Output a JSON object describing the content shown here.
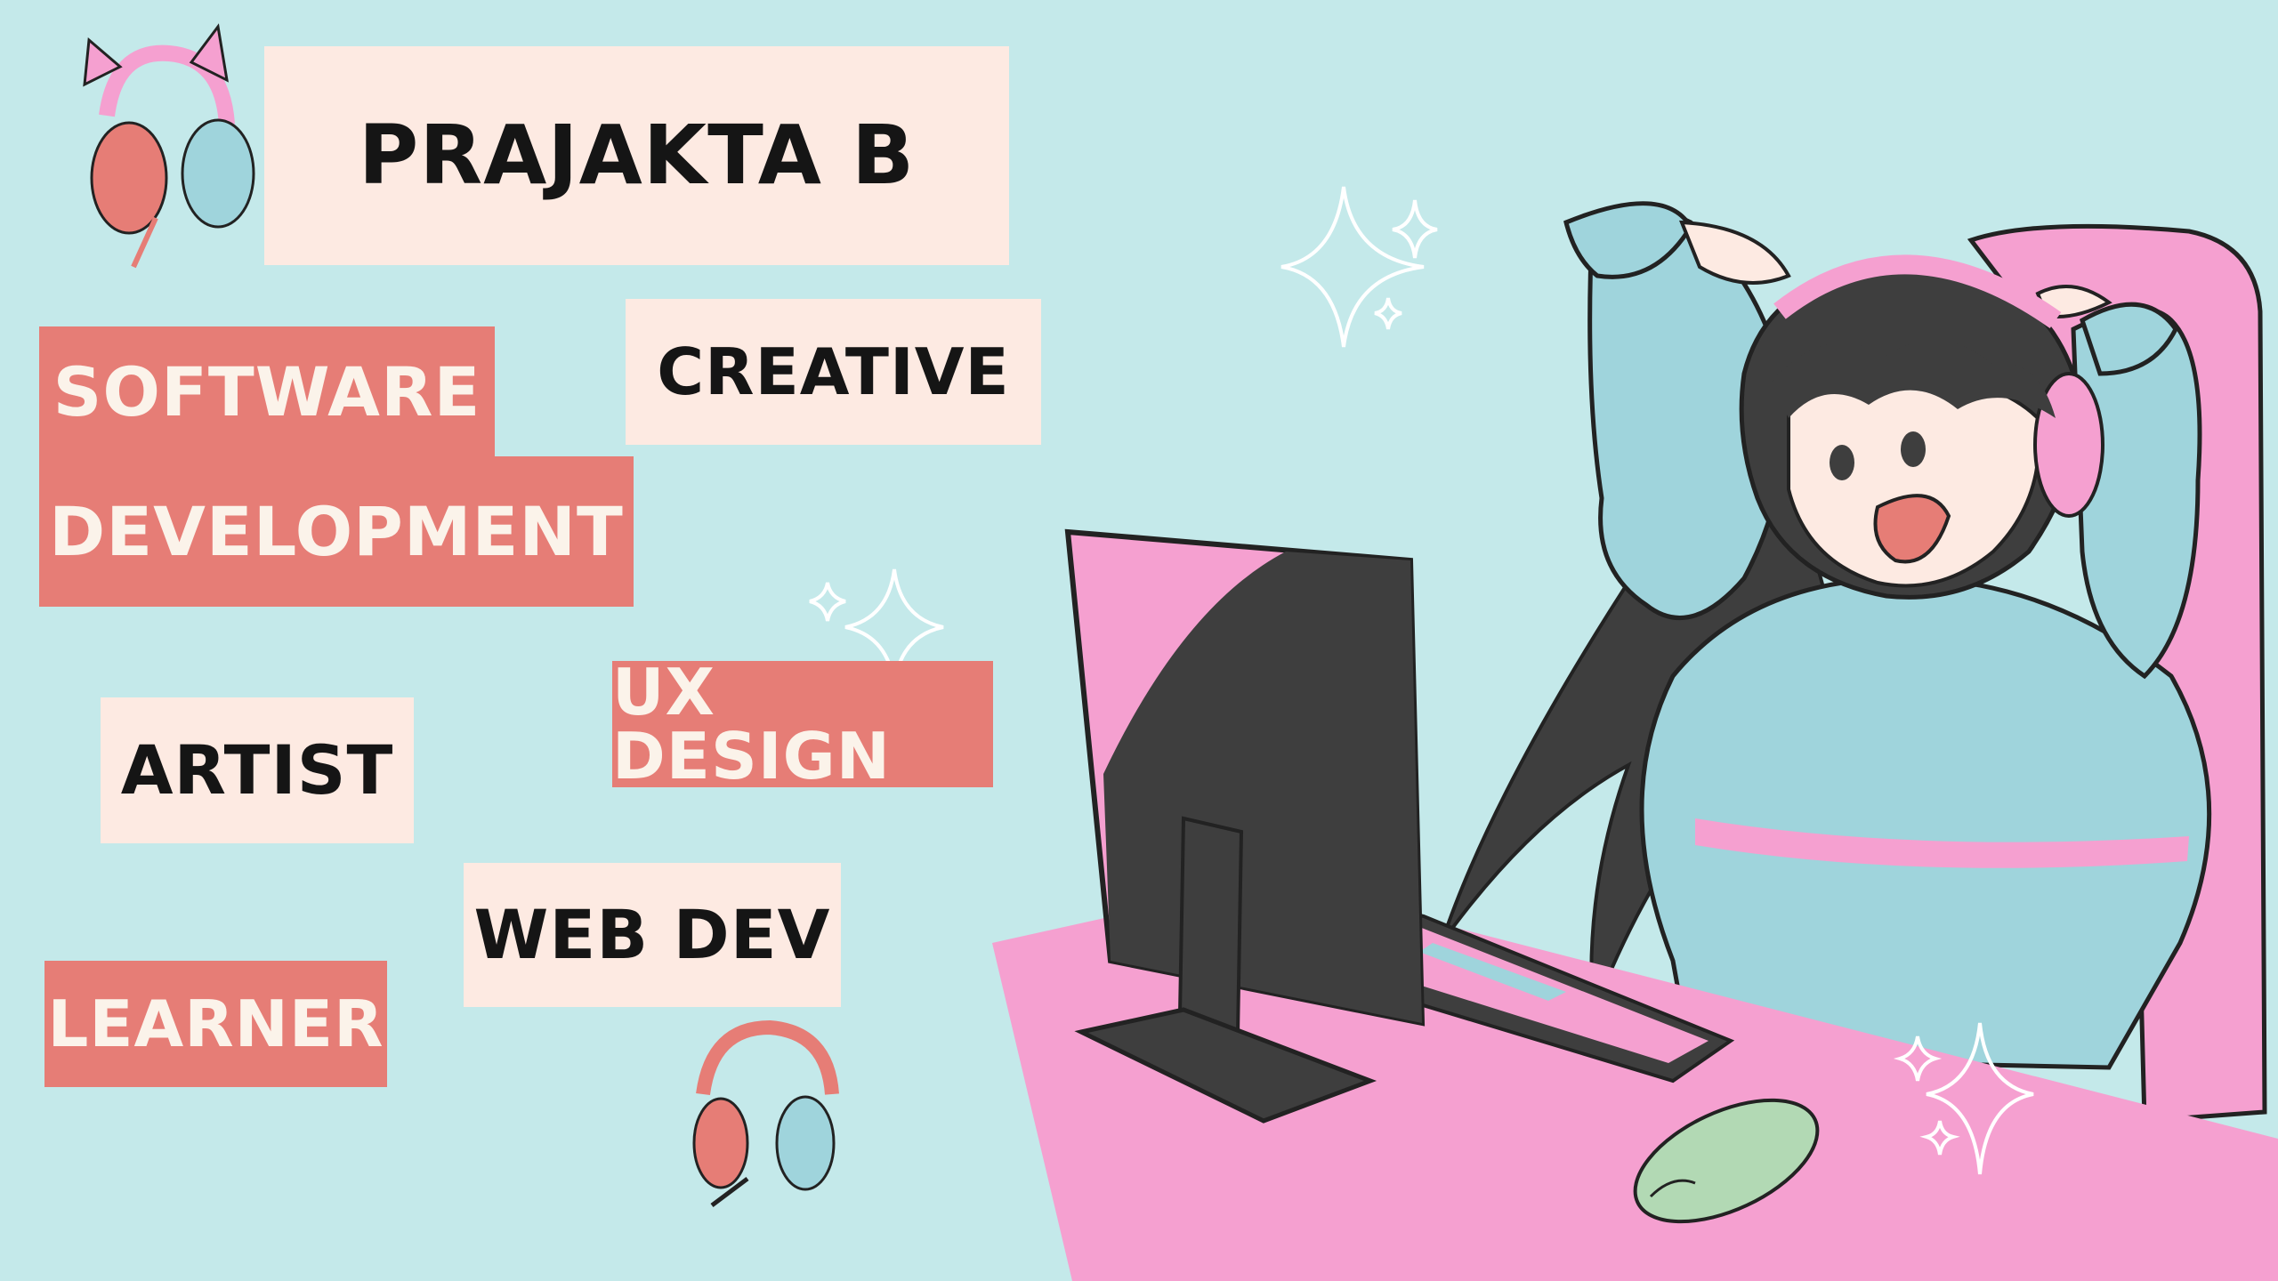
{
  "name": "PRAJAKTA B",
  "tags": {
    "creative": "CREATIVE",
    "software": "SOFTWARE",
    "development": "DEVELOPMENT",
    "artist": "ARTIST",
    "ux_design": "UX DESIGN",
    "web_dev": "WEB DEV",
    "learner": "LEARNER"
  },
  "colors": {
    "background": "#c4e9ea",
    "cream": "#fdeae2",
    "coral": "#e67d76",
    "pink": "#f5a0d0",
    "blue": "#9fd4dc",
    "dark": "#3e3e3e",
    "mint": "#b2d9b4"
  },
  "icons": [
    "cat-ear-headphones-icon",
    "headphones-icon",
    "sparkle-icon"
  ]
}
